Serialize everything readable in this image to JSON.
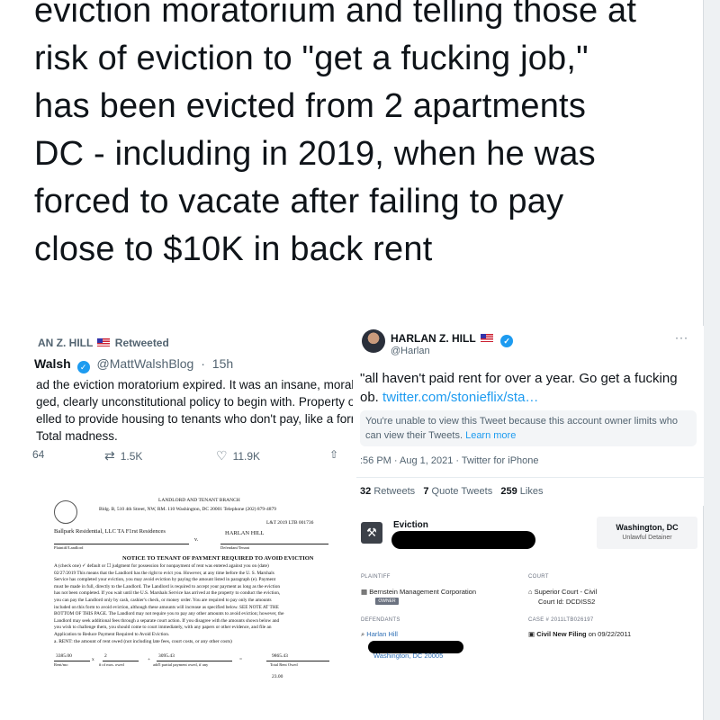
{
  "headline": {
    "lines": [
      "eviction moratorium and telling those at",
      "risk of eviction to \"get a fucking job,\"",
      "has been evicted from 2 apartments",
      "DC - including in 2019, when he was",
      "forced to vacate after failing to pay",
      "close to $10K in back rent"
    ]
  },
  "left_tweet": {
    "retweeted_by": "AN Z. HILL",
    "retweeted_label": "Retweeted",
    "author_name": "Walsh",
    "author_handle": "@MattWalshBlog",
    "time": "15h",
    "body": [
      "ad the eviction moratorium expired. It was an insane, morally",
      "ged, clearly unconstitutional policy to begin with. Property o",
      "elled to provide housing to tenants who don't pay, like a form",
      "Total madness."
    ],
    "replies": "64",
    "retweets": "1.5K",
    "likes": "11.9K"
  },
  "right_tweet": {
    "name": "HARLAN Z. HILL",
    "handle": "@Harlan",
    "more": "···",
    "body_line1": "\"all haven't paid rent for over a year. Go get a fucking",
    "body_line2_prefix": "ob.",
    "body_link": "twitter.com/stonieflix/sta…",
    "notice_text": "You're unable to view this Tweet because this account owner limits who can view their Tweets.",
    "notice_link": "Learn more",
    "timestamp": ":56 PM · Aug 1, 2021 · Twitter for iPhone",
    "retweets_count": "32",
    "retweets_label": "Retweets",
    "quotes_count": "7",
    "quotes_label": "Quote Tweets",
    "likes_count": "259",
    "likes_label": "Likes"
  },
  "court_doc": {
    "branch": "LANDLORD AND TENANT BRANCH",
    "address": "Bldg. B, 510 4th Street, NW, RM. 110 Washington, DC 20001 Telephone (202) 879-4879",
    "case_no": "L&T 2019 LTB 001736",
    "plaintiff": "Ballpark Residential, LLC TA F1rst Residences",
    "defendant": "HARLAN HILL",
    "v": "v.",
    "plaintiff_label": "Plaintiff/Landlord",
    "defendant_label": "Defendant/Tenant",
    "notice_title": "NOTICE TO TENANT OF PAYMENT REQUIRED TO AVOID EVICTION",
    "paragraph": [
      "A (check one) ✓ default or ☐ judgment for possession for nonpayment of rent was entered against you on (date)",
      "02/27/2019   This means that the Landlord has the right to evict you. However, at any time before the U. S. Marshals",
      "Service has completed your eviction, you may avoid eviction by paying the amount listed in paragraph (e). Payment",
      "must be made in full, directly to the Landlord. The Landlord is required to accept your payment as long as the eviction",
      "has not been completed. If you wait until the U.S. Marshals Service has arrived at the property to conduct the eviction,",
      "you can pay the Landlord only by cash, cashier's check, or money order. You are required to pay only the amounts",
      "included on this form to avoid eviction, although these amounts will increase as specified below. SEE NOTE AT THE",
      "BOTTOM OF THIS PAGE. The Landlord may not require you to pay any other amounts to avoid eviction; however, the",
      "Landlord may seek additional fees through a separate court action. If you disagree with the amounts shown below and",
      "you wish to challenge them, you should come to court immediately, with any papers or other evidence, and file an",
      "Application to Reduce Payment Required to Avoid Eviction."
    ],
    "rent_line": "a. RENT: the amount of rent owed (not including late fees, court costs, or any other costs)",
    "rent_per_mo": "3385.00",
    "months": "2",
    "partial": "3095.43",
    "total": "9865.43",
    "rent_label": "Rent/mo",
    "months_label": "# of mos. owed",
    "partial_label": "add'l partial payment owed, if any",
    "total_label": "Total Rent Owed",
    "next_value": "23.00"
  },
  "case_record": {
    "title": "Eviction",
    "location": "Washington, DC",
    "case_type": "Unlawful Detainer",
    "plaintiff_label": "PLAINTIFF",
    "plaintiff": "Bernstein Management Corporation",
    "owner_badge": "OWNER",
    "court_label": "COURT",
    "court": "Superior Court - Civil",
    "court_id": "Court Id: DCDISS2",
    "defendants_label": "DEFENDANTS",
    "defendant": "Harlan Hill",
    "defendant_city": "Washington, DC 20005",
    "case_no": "CASE # 2011LTB026197",
    "filing": "Civil New Filing",
    "filing_date": "on 09/22/2011"
  }
}
